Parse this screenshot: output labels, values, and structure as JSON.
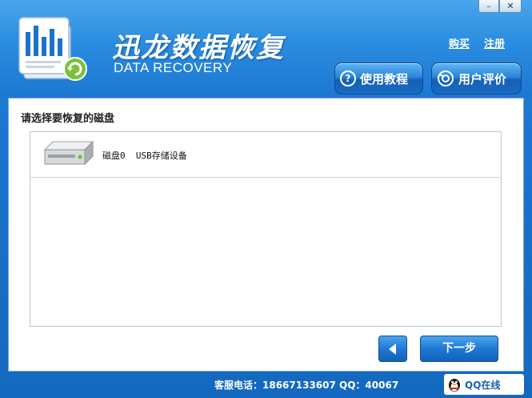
{
  "window": {
    "minimize_symbol": "–",
    "close_symbol": "✕"
  },
  "header": {
    "title": "迅龙数据恢复",
    "subtitle": "DATA RECOVERY",
    "buy_link": "购买",
    "register_link": "注册",
    "tutorial_button": "使用教程",
    "tutorial_icon": "?",
    "review_button": "用户评价"
  },
  "main": {
    "prompt": "请选择要恢复的磁盘",
    "disks": [
      {
        "label": "磁盘0  USB存储设备",
        "icon": "hard-drive-icon"
      }
    ]
  },
  "nav": {
    "next_label": "下一步",
    "back_icon": "left-arrow-icon"
  },
  "footer": {
    "service_text": "客服电话：18667133607 QQ：40067",
    "qq_badge": "QQ在线"
  },
  "colors": {
    "accent": "#1b76cf",
    "header_light": "#49a6ec",
    "button": "#1f79d2"
  }
}
